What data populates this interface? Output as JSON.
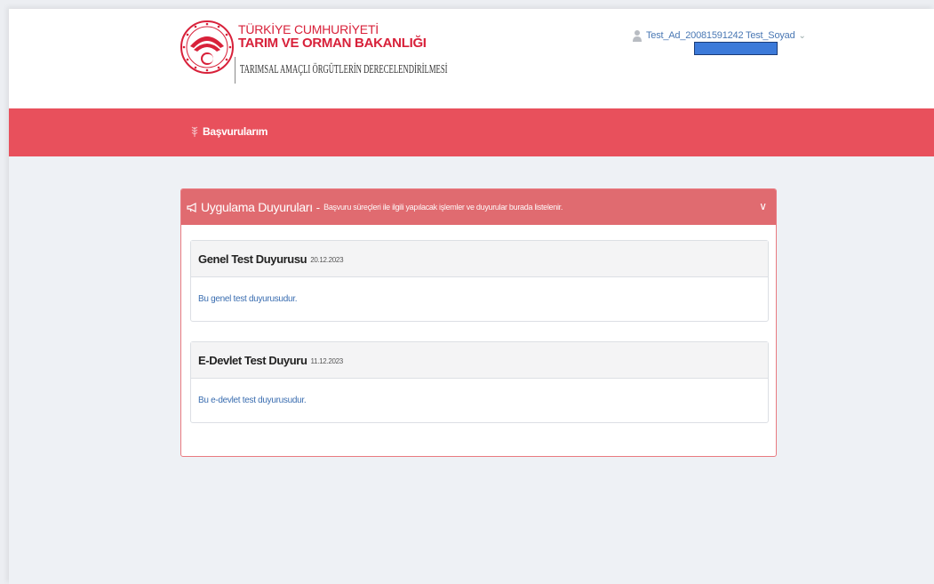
{
  "header": {
    "ministry_line1": "TÜRKİYE CUMHURİYETİ",
    "ministry_line2": "TARIM VE ORMAN BAKANLIĞI",
    "app_name": "TARIMSAL AMAÇLI ÖRGÜTLERİN DERECELENDİRİLMESİ",
    "user_name": "Test_Ad_20081591242 Test_Soyad",
    "user_menu_chevron": "⌄",
    "brand_color": "#d8213a"
  },
  "nav": {
    "items": [
      {
        "label": "Başvurularım",
        "icon": "wheat-icon"
      }
    ],
    "color": "#e8505c"
  },
  "announcements": {
    "title": "Uygulama Duyuruları",
    "separator": "-",
    "subtitle": "Başvuru süreçleri ile ilgili yapılacak işlemler ve duyurular burada listelenir.",
    "collapse_symbol": "∨",
    "items": [
      {
        "title": "Genel Test Duyurusu",
        "date": "20.12.2023",
        "body": "Bu genel test duyurusudur."
      },
      {
        "title": "E-Devlet Test Duyuru",
        "date": "11.12.2023",
        "body": "Bu e-devlet test duyurusudur."
      }
    ]
  }
}
